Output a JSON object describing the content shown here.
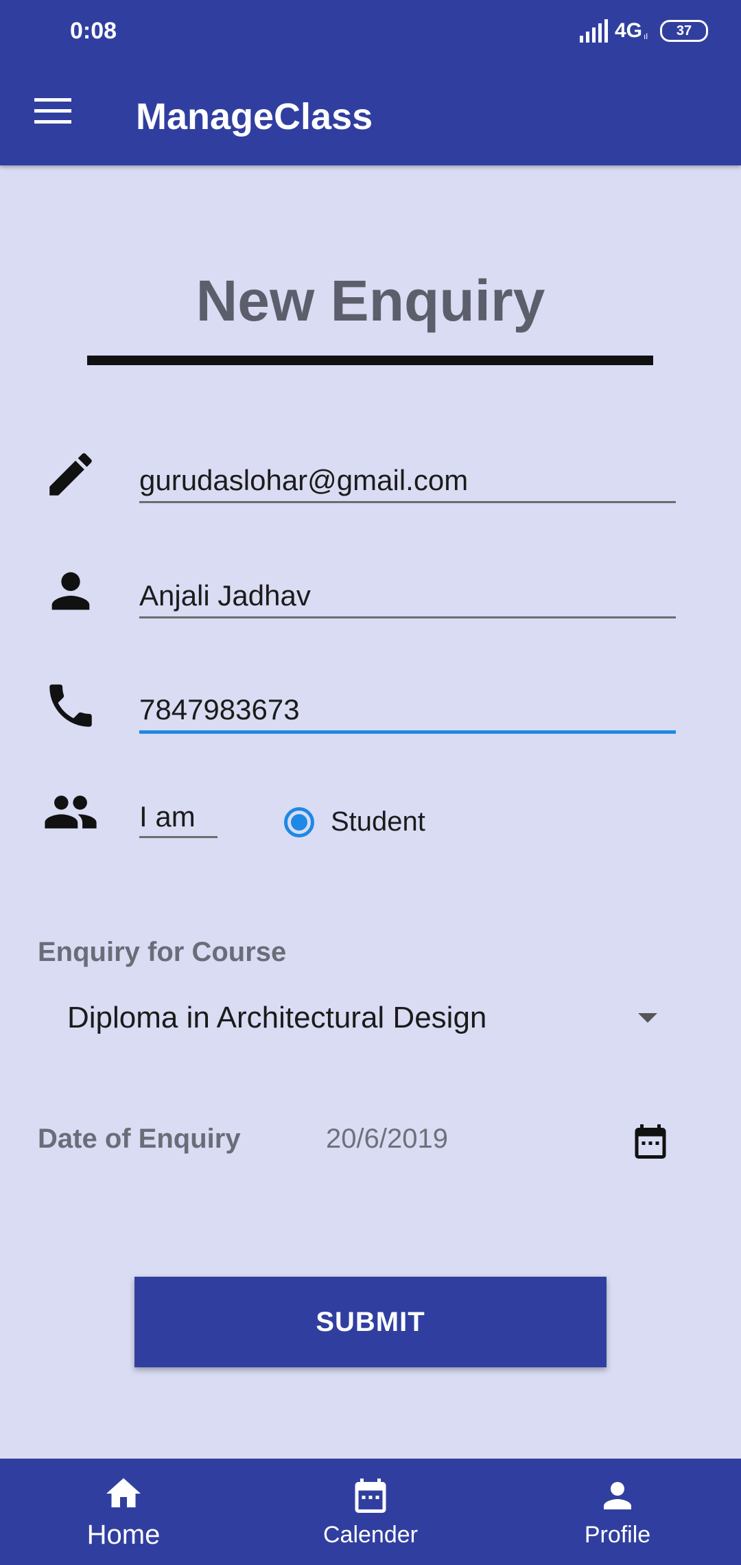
{
  "status_bar": {
    "time": "0:08",
    "network": "4G",
    "network_sub": "ıl",
    "battery": "37"
  },
  "app_bar": {
    "title": "ManageClass",
    "menu_icon": "hamburger-menu-icon"
  },
  "form": {
    "heading": "New Enquiry",
    "email": {
      "icon": "pencil-icon",
      "value": "gurudaslohar@gmail.com"
    },
    "name": {
      "icon": "person-icon",
      "value": "Anjali Jadhav"
    },
    "phone": {
      "icon": "phone-icon",
      "value": "7847983673"
    },
    "role": {
      "icon": "people-icon",
      "label": "I am",
      "option": "Student",
      "selected": true
    },
    "course": {
      "label": "Enquiry for Course",
      "selected": "Diploma in Architectural Design"
    },
    "date": {
      "label": "Date of Enquiry",
      "value": "20/6/2019",
      "icon": "calendar-icon"
    },
    "submit_label": "SUBMIT"
  },
  "bottom_nav": {
    "items": [
      {
        "label": "Home",
        "icon": "home-icon",
        "active": true
      },
      {
        "label": "Calender",
        "icon": "calendar-icon",
        "active": false
      },
      {
        "label": "Profile",
        "icon": "person-icon",
        "active": false
      }
    ]
  },
  "colors": {
    "primary": "#303f9f",
    "background": "#d9dcf3",
    "accent": "#1e88e5"
  }
}
